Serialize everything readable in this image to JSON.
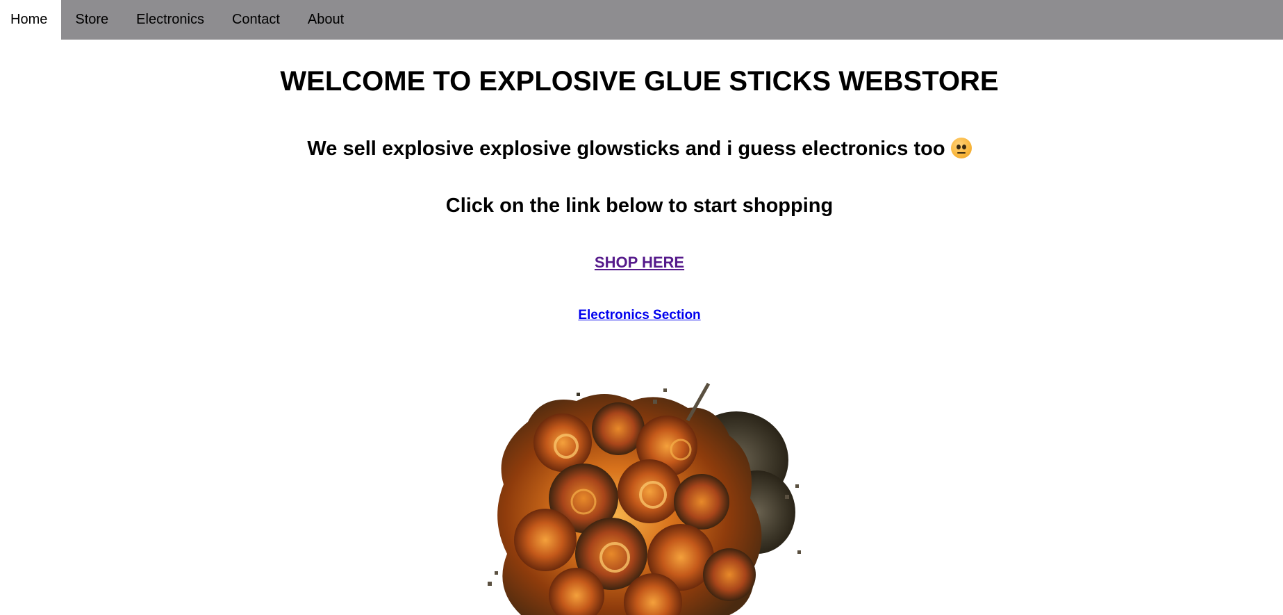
{
  "nav": {
    "items": [
      {
        "label": "Home",
        "active": true
      },
      {
        "label": "Store",
        "active": false
      },
      {
        "label": "Electronics",
        "active": false
      },
      {
        "label": "Contact",
        "active": false
      },
      {
        "label": "About",
        "active": false
      }
    ]
  },
  "main": {
    "title": "WELCOME TO EXPLOSIVE GLUE STICKS WEBSTORE",
    "subtitle": "We sell explosive explosive glowsticks and i guess electronics too",
    "subtitle_emoji": "neutral-face-icon",
    "prompt": "Click on the link below to start shopping",
    "shop_link": "SHOP HERE",
    "electronics_link": "Electronics Section",
    "image": "explosion-image"
  },
  "colors": {
    "nav_bg": "#8e8d90",
    "visited_link": "#551a8b",
    "link": "#0000ee"
  }
}
